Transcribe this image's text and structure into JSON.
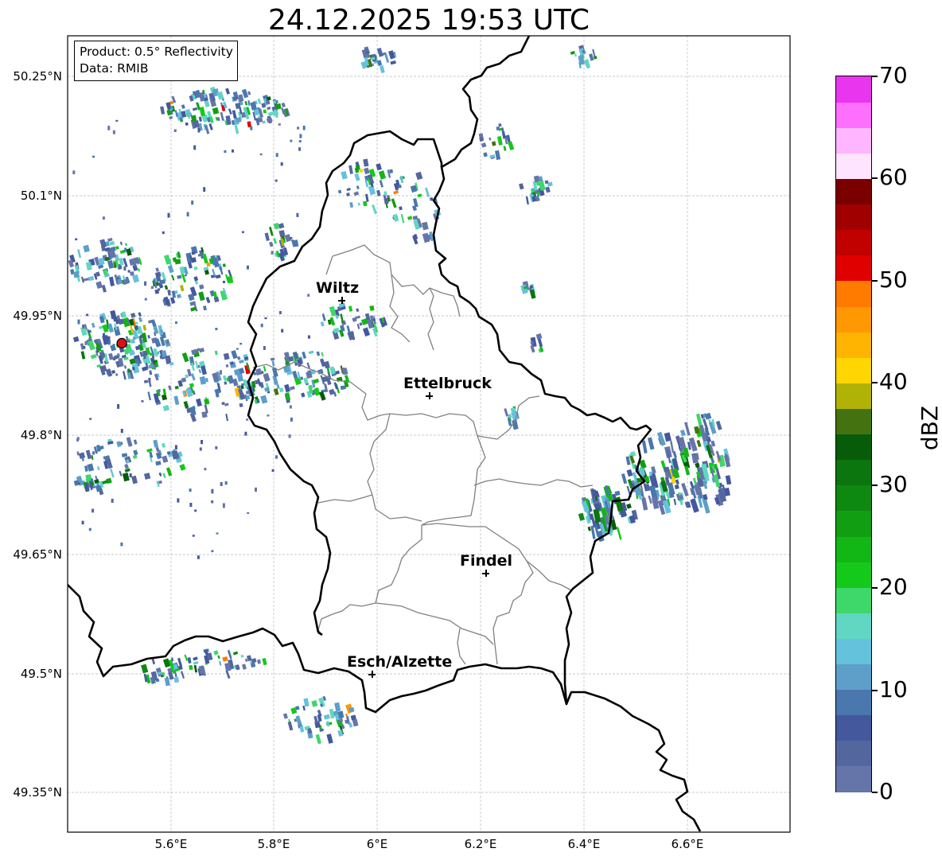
{
  "title": "24.12.2025 19:53 UTC",
  "info": {
    "product": "Product: 0.5° Reflectivity",
    "data": "Data: RMIB"
  },
  "map": {
    "lon_range": [
      5.4,
      6.8
    ],
    "lat_range": [
      49.3,
      50.3
    ],
    "lat_ticks": [
      "50.25°N",
      "50.1°N",
      "49.95°N",
      "49.8°N",
      "49.65°N",
      "49.5°N",
      "49.35°N"
    ],
    "lon_ticks": [
      "5.6°E",
      "5.8°E",
      "6°E",
      "6.2°E",
      "6.4°E",
      "6.6°E"
    ],
    "grid": true,
    "radar_site": {
      "lon": 5.505,
      "lat": 49.914,
      "color": "#dd1111"
    }
  },
  "cities": [
    {
      "name": "Wiltz",
      "lon": 5.933,
      "lat": 49.966
    },
    {
      "name": "Ettelbruck",
      "lon": 6.104,
      "lat": 49.847
    },
    {
      "name": "Findel",
      "lon": 6.211,
      "lat": 49.626
    },
    {
      "name": "Esch/Alzette",
      "lon": 5.987,
      "lat": 49.497
    }
  ],
  "colorbar": {
    "label": "dBZ",
    "min": 0,
    "max": 70,
    "ticks": [
      "0",
      "10",
      "20",
      "30",
      "40",
      "50",
      "60",
      "70"
    ],
    "colors": [
      "#6675a9",
      "#54669e",
      "#44589d",
      "#4a77ad",
      "#5d9fc8",
      "#65c2dc",
      "#61d6c3",
      "#3ed76a",
      "#14c91a",
      "#12b716",
      "#119e13",
      "#0f8811",
      "#0b750e",
      "#075c0a",
      "#447210",
      "#b1b206",
      "#ffd502",
      "#ffb401",
      "#ff9802",
      "#ff7b00",
      "#e10000",
      "#c10000",
      "#a10000",
      "#7a0000",
      "#ffe4ff",
      "#ffb6ff",
      "#ff6ffe",
      "#e935ee"
    ]
  }
}
